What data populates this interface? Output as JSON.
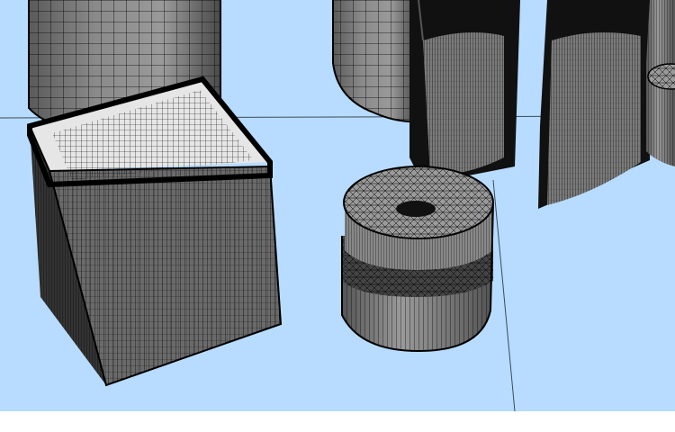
{
  "viewport": {
    "background_color": "#b8dcff",
    "mesh_fill_color": "#6e6e6e",
    "mesh_light_color": "#d8d8d8",
    "mesh_line_color": "#000000",
    "guide_line_color": "#3a4a5a"
  },
  "objects": [
    {
      "name": "cylinder",
      "kind": "wireframe-mesh"
    },
    {
      "name": "cube-box",
      "kind": "wireframe-mesh"
    },
    {
      "name": "capsule-bottle",
      "kind": "wireframe-mesh"
    },
    {
      "name": "pouch-left",
      "kind": "wireframe-mesh"
    },
    {
      "name": "pouch-right",
      "kind": "wireframe-mesh"
    },
    {
      "name": "round-jar",
      "kind": "wireframe-mesh"
    },
    {
      "name": "small-jar",
      "kind": "wireframe-mesh"
    }
  ]
}
